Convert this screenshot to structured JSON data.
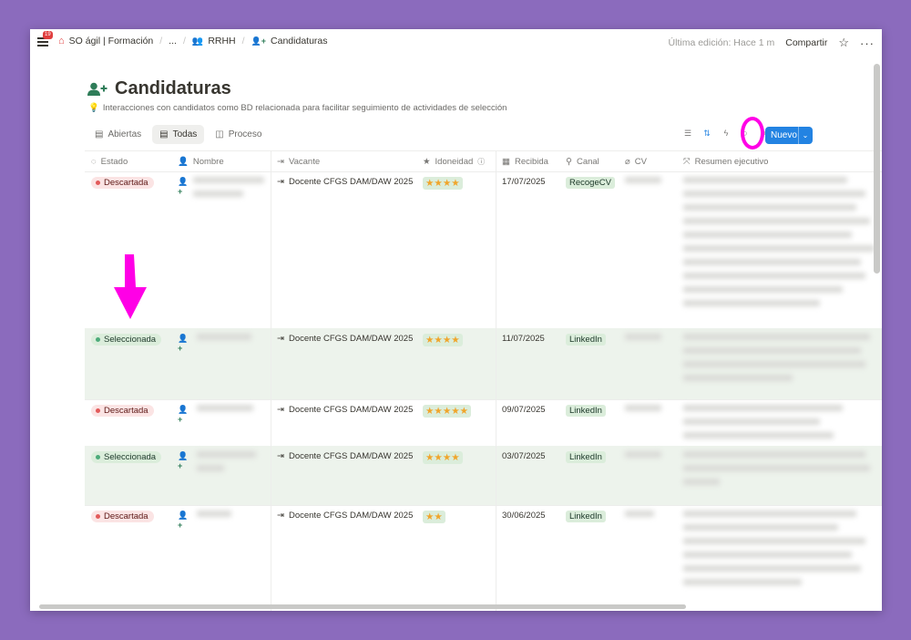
{
  "topbar": {
    "notif_count": "19",
    "workspace": "SO ágil | Formación",
    "ellipsis": "...",
    "section": "RRHH",
    "page": "Candidaturas",
    "last_edit": "Última edición: Hace 1 m",
    "share": "Compartir"
  },
  "header": {
    "title": "Candidaturas",
    "description": "Interacciones con candidatos como BD relacionada para facilitar seguimiento de actividades de selección"
  },
  "tabs": [
    {
      "label": "Abiertas",
      "icon": "table-icon"
    },
    {
      "label": "Todas",
      "icon": "table-icon",
      "active": true
    },
    {
      "label": "Proceso",
      "icon": "board-icon"
    }
  ],
  "toolbar": {
    "new_label": "Nuevo"
  },
  "columns": [
    "Estado",
    "Nombre",
    "Vacante",
    "Idoneidad",
    "Recibida",
    "Canal",
    "CV",
    "Resumen ejecutivo"
  ],
  "rows": [
    {
      "estado": "Descartada",
      "vacante": "Docente CFGS DAM/DAW 2025",
      "idoneidad": "★★★★",
      "stars": 4,
      "recibida": "17/07/2025",
      "canal": "RecogeCV"
    },
    {
      "estado": "Seleccionada",
      "vacante": "Docente CFGS DAM/DAW 2025",
      "idoneidad": "★★★★",
      "stars": 4,
      "recibida": "11/07/2025",
      "canal": "LinkedIn"
    },
    {
      "estado": "Descartada",
      "vacante": "Docente CFGS DAM/DAW 2025",
      "idoneidad": "★★★★★",
      "stars": 5,
      "recibida": "09/07/2025",
      "canal": "LinkedIn"
    },
    {
      "estado": "Seleccionada",
      "vacante": "Docente CFGS DAM/DAW 2025",
      "idoneidad": "★★★★",
      "stars": 4,
      "recibida": "03/07/2025",
      "canal": "LinkedIn"
    },
    {
      "estado": "Descartada",
      "vacante": "Docente CFGS DAM/DAW 2025",
      "idoneidad": "★★",
      "stars": 2,
      "recibida": "30/06/2025",
      "canal": "LinkedIn"
    }
  ],
  "colors": {
    "background": "#8b6bbd",
    "accent": "#2383e2",
    "highlight": "#ff00e6",
    "selected_row": "#edf3ec",
    "star": "#f0a52b"
  }
}
